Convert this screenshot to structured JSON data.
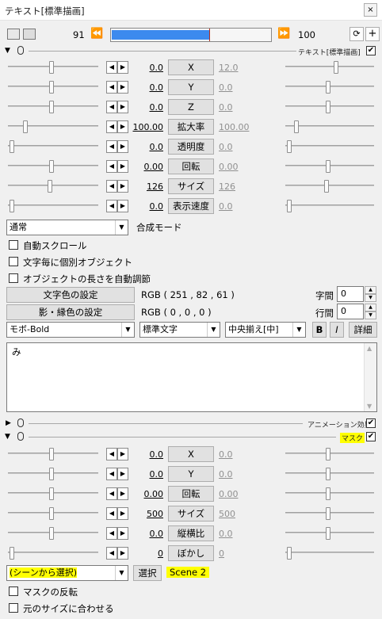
{
  "window": {
    "title": "テキスト[標準描画]",
    "close": "×"
  },
  "timeline": {
    "start": "91",
    "end": "100",
    "progress": 0.62
  },
  "text_section": {
    "label": "テキスト[標準描画]",
    "checked": true
  },
  "rows1": [
    {
      "name": "x",
      "left": "0.0",
      "label": "X",
      "right": "12.0",
      "rightGrey": true,
      "slL": 0.48,
      "slR": 0.58
    },
    {
      "name": "y",
      "left": "0.0",
      "label": "Y",
      "right": "0.0",
      "rightGrey": true,
      "slL": 0.48,
      "slR": 0.48
    },
    {
      "name": "z",
      "left": "0.0",
      "label": "Z",
      "right": "0.0",
      "rightGrey": true,
      "slL": 0.48,
      "slR": 0.48
    },
    {
      "name": "scale",
      "left": "100.00",
      "label": "拡大率",
      "right": "100.00",
      "rightGrey": true,
      "slL": 0.18,
      "slR": 0.1
    },
    {
      "name": "opacity",
      "left": "0.0",
      "label": "透明度",
      "right": "0.0",
      "rightGrey": true,
      "slL": 0.02,
      "slR": 0.02
    },
    {
      "name": "rotation",
      "left": "0.00",
      "label": "回転",
      "right": "0.00",
      "rightGrey": true,
      "slL": 0.48,
      "slR": 0.48
    },
    {
      "name": "size",
      "left": "126",
      "label": "サイズ",
      "right": "126",
      "rightGrey": true,
      "slL": 0.46,
      "slR": 0.46
    },
    {
      "name": "speed",
      "left": "0.0",
      "label": "表示速度",
      "right": "0.0",
      "rightGrey": true,
      "slL": 0.02,
      "slR": 0.02
    }
  ],
  "blend": {
    "value": "通常",
    "label": "合成モード"
  },
  "checks1": [
    {
      "label": "自動スクロール"
    },
    {
      "label": "文字毎に個別オブジェクト"
    },
    {
      "label": "オブジェクトの長さを自動調節"
    }
  ],
  "color": {
    "button": "文字色の設定",
    "value": "RGB ( 251 , 82 , 61 )",
    "spacing_label": "字間",
    "spacing": "0"
  },
  "shadow": {
    "button": "影・縁色の設定",
    "value": "RGB ( 0 , 0 , 0 )",
    "line_label": "行間",
    "line": "0"
  },
  "font": {
    "family": "モボ-Bold",
    "style": "標準文字",
    "align": "中央揃え[中]",
    "bold": "B",
    "italic": "I",
    "detail": "詳細"
  },
  "text_content": "み",
  "anim": {
    "label": "アニメーション効果",
    "checked": true
  },
  "mask": {
    "label": "マスク",
    "checked": true
  },
  "rows2": [
    {
      "name": "x",
      "left": "0.0",
      "label": "X",
      "right": "0.0",
      "slL": 0.48,
      "slR": 0.48
    },
    {
      "name": "y",
      "left": "0.0",
      "label": "Y",
      "right": "0.0",
      "slL": 0.48,
      "slR": 0.48
    },
    {
      "name": "rotation",
      "left": "0.00",
      "label": "回転",
      "right": "0.00",
      "slL": 0.48,
      "slR": 0.48
    },
    {
      "name": "size",
      "left": "500",
      "label": "サイズ",
      "right": "500",
      "slL": 0.48,
      "slR": 0.48
    },
    {
      "name": "aspect",
      "left": "0.0",
      "label": "縦横比",
      "right": "0.0",
      "slL": 0.48,
      "slR": 0.48
    },
    {
      "name": "blur",
      "left": "0",
      "label": "ぼかし",
      "right": "0",
      "slL": 0.02,
      "slR": 0.02
    }
  ],
  "scene": {
    "combo": "(シーンから選択)",
    "select": "選択",
    "value": "Scene 2"
  },
  "checks2": [
    {
      "label": "マスクの反転"
    },
    {
      "label": "元のサイズに合わせる"
    }
  ]
}
